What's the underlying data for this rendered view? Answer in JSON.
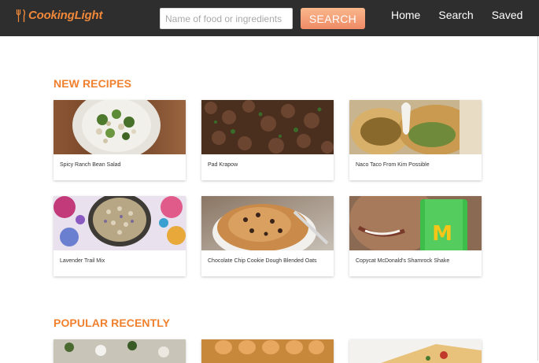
{
  "header": {
    "brand": "CookingLight",
    "brand_icon": "fork-knife-icon",
    "search_placeholder": "Name of food or ingredients",
    "search_value": "",
    "search_button": "SEARCH",
    "nav": [
      "Home",
      "Search",
      "Saved"
    ]
  },
  "sections": {
    "new_recipes": {
      "title": "NEW RECIPES",
      "items": [
        "Spicy Ranch Bean Salad",
        "Pad Krapow",
        "Naco Taco From Kim Possible",
        "Lavender Trail Mix",
        "Chocolate Chip Cookie Dough Blended Oats",
        "Copycat McDonald's Shamrock Shake"
      ]
    },
    "popular_recently": {
      "title": "POPULAR RECENTLY"
    }
  },
  "colors": {
    "navbar": "#2e2e2e",
    "brand": "#f0883a",
    "accent": "#f0802e",
    "button": "#f4a078"
  }
}
